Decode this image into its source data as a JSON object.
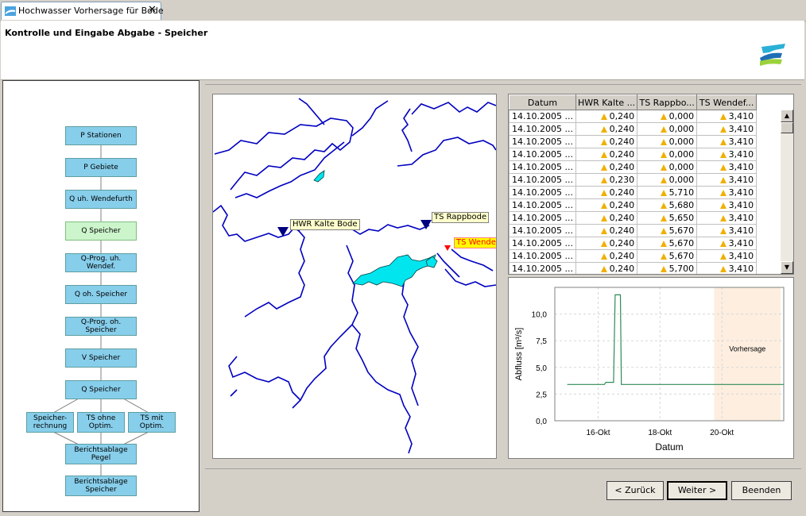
{
  "tab": {
    "label": "Hochwasser Vorhersage für Bode",
    "close_glyph": "✕"
  },
  "header": {
    "title": "Kontrolle und Eingabe Abgabe - Speicher"
  },
  "flow": {
    "steps": [
      "P Stationen",
      "P Gebiete",
      "Q uh. Wendefurth",
      "Q Speicher",
      "Q-Prog. uh. Wendef.",
      "Q oh. Speicher",
      "Q-Prog. oh. Speicher",
      "V Speicher",
      "Q Speicher"
    ],
    "branch": [
      {
        "line1": "Speicher-",
        "line2": "rechnung"
      },
      {
        "line1": "TS ohne",
        "line2": "Optim."
      },
      {
        "line1": "TS mit",
        "line2": "Optim."
      }
    ],
    "report1": {
      "line1": "Berichtsablage",
      "line2": "Pegel"
    },
    "report2": {
      "line1": "Berichtsablage",
      "line2": "Speicher"
    },
    "active_index": 3
  },
  "map": {
    "labels": {
      "hwr": "HWR Kalte Bode",
      "rapp": "TS Rappbode",
      "wende": "TS Wendef"
    }
  },
  "table": {
    "headers": [
      "Datum",
      "HWR Kalte ...",
      "TS Rappbo...",
      "TS Wendef..."
    ],
    "rows": [
      [
        "14.10.2005 ...",
        "0,240",
        "0,000",
        "3,410"
      ],
      [
        "14.10.2005 ...",
        "0,240",
        "0,000",
        "3,410"
      ],
      [
        "14.10.2005 ...",
        "0,240",
        "0,000",
        "3,410"
      ],
      [
        "14.10.2005 ...",
        "0,240",
        "0,000",
        "3,410"
      ],
      [
        "14.10.2005 ...",
        "0,240",
        "0,000",
        "3,410"
      ],
      [
        "14.10.2005 ...",
        "0,230",
        "0,000",
        "3,410"
      ],
      [
        "14.10.2005 ...",
        "0,240",
        "5,710",
        "3,410"
      ],
      [
        "14.10.2005 ...",
        "0,240",
        "5,680",
        "3,410"
      ],
      [
        "14.10.2005 ...",
        "0,240",
        "5,650",
        "3,410"
      ],
      [
        "14.10.2005 ...",
        "0,240",
        "5,670",
        "3,410"
      ],
      [
        "14.10.2005 ...",
        "0,240",
        "5,670",
        "3,410"
      ],
      [
        "14.10.2005 ...",
        "0,240",
        "5,670",
        "3,410"
      ],
      [
        "14.10.2005 ...",
        "0,240",
        "5,700",
        "3,410"
      ]
    ]
  },
  "chart_data": {
    "type": "line",
    "xlabel": "Datum",
    "ylabel": "Abfluss [m³/s]",
    "x_ticks": [
      "16-Okt",
      "18-Okt",
      "20-Okt"
    ],
    "y_ticks": [
      "0,0",
      "2,5",
      "5,0",
      "7,5",
      "10,0"
    ],
    "ylim": [
      0,
      12.5
    ],
    "xlim_days": [
      14.6,
      22.0
    ],
    "forecast_label": "Vorhersage",
    "forecast_from_day": 19.75,
    "grid": true,
    "series": [
      {
        "days": [
          15.0,
          16.2,
          16.25,
          16.5,
          16.55,
          16.72,
          16.75,
          22.0
        ],
        "values": [
          3.4,
          3.4,
          3.6,
          3.6,
          11.8,
          11.8,
          3.4,
          3.4
        ]
      }
    ]
  },
  "buttons": {
    "back": "< Zurück",
    "next": "Weiter >",
    "finish": "Beenden"
  },
  "colors": {
    "flow_box": "#87ceeb",
    "flow_active": "#ccf5cc",
    "river": "#0000c0",
    "reservoir": "#00e5ee",
    "series": "#2e8b57",
    "forecast_bg": "#fdeee0"
  }
}
